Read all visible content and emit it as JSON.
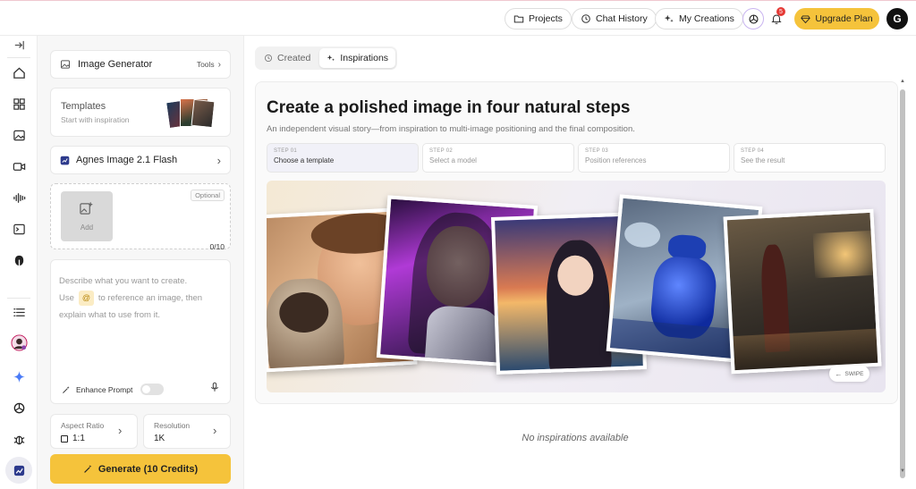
{
  "topbar": {
    "projects": "Projects",
    "chat_history": "Chat History",
    "my_creations": "My Creations",
    "notification_count": "5",
    "upgrade": "Upgrade Plan",
    "avatar_letter": "G"
  },
  "panel": {
    "generator_label": "Image Generator",
    "tools_label": "Tools",
    "templates_title": "Templates",
    "templates_sub": "Start with inspiration",
    "model_name": "Agnes Image 2.1 Flash",
    "optional_label": "Optional",
    "add_label": "Add",
    "upload_count": "0/10",
    "prompt_line1": "Describe what you want to create.",
    "prompt_use": "Use",
    "prompt_at": "@",
    "prompt_ref": "to reference an image, then",
    "prompt_line3": "explain what to use from it.",
    "enhance_label": "Enhance Prompt",
    "aspect_label": "Aspect Ratio",
    "aspect_value": "1:1",
    "resolution_label": "Resolution",
    "resolution_value": "1K",
    "generate_label": "Generate (10 Credits)"
  },
  "main": {
    "tabs": [
      {
        "label": "Created",
        "active": false
      },
      {
        "label": "Inspirations",
        "active": true
      }
    ],
    "title": "Create a polished image in four natural steps",
    "subtitle": "An independent visual story—from inspiration to multi-image positioning and the final composition.",
    "steps": [
      {
        "num": "STEP 01",
        "title": "Choose a template"
      },
      {
        "num": "STEP 02",
        "title": "Select a model"
      },
      {
        "num": "STEP 03",
        "title": "Position references"
      },
      {
        "num": "STEP 04",
        "title": "See the result"
      }
    ],
    "swipe_label": "SWIPE",
    "empty_label": "No inspirations available"
  },
  "colors": {
    "accent_yellow": "#f5c33b",
    "brand_pink": "#e8557a",
    "step_active_bg": "#f1f1f8"
  },
  "icons": [
    "logo-icon",
    "collapse-icon",
    "home-icon",
    "apps-icon",
    "image-icon",
    "video-icon",
    "audio-icon",
    "terminal-icon",
    "mask-icon",
    "list-icon",
    "sparkle-icon",
    "openai-icon",
    "bug-icon",
    "chart-icon"
  ]
}
